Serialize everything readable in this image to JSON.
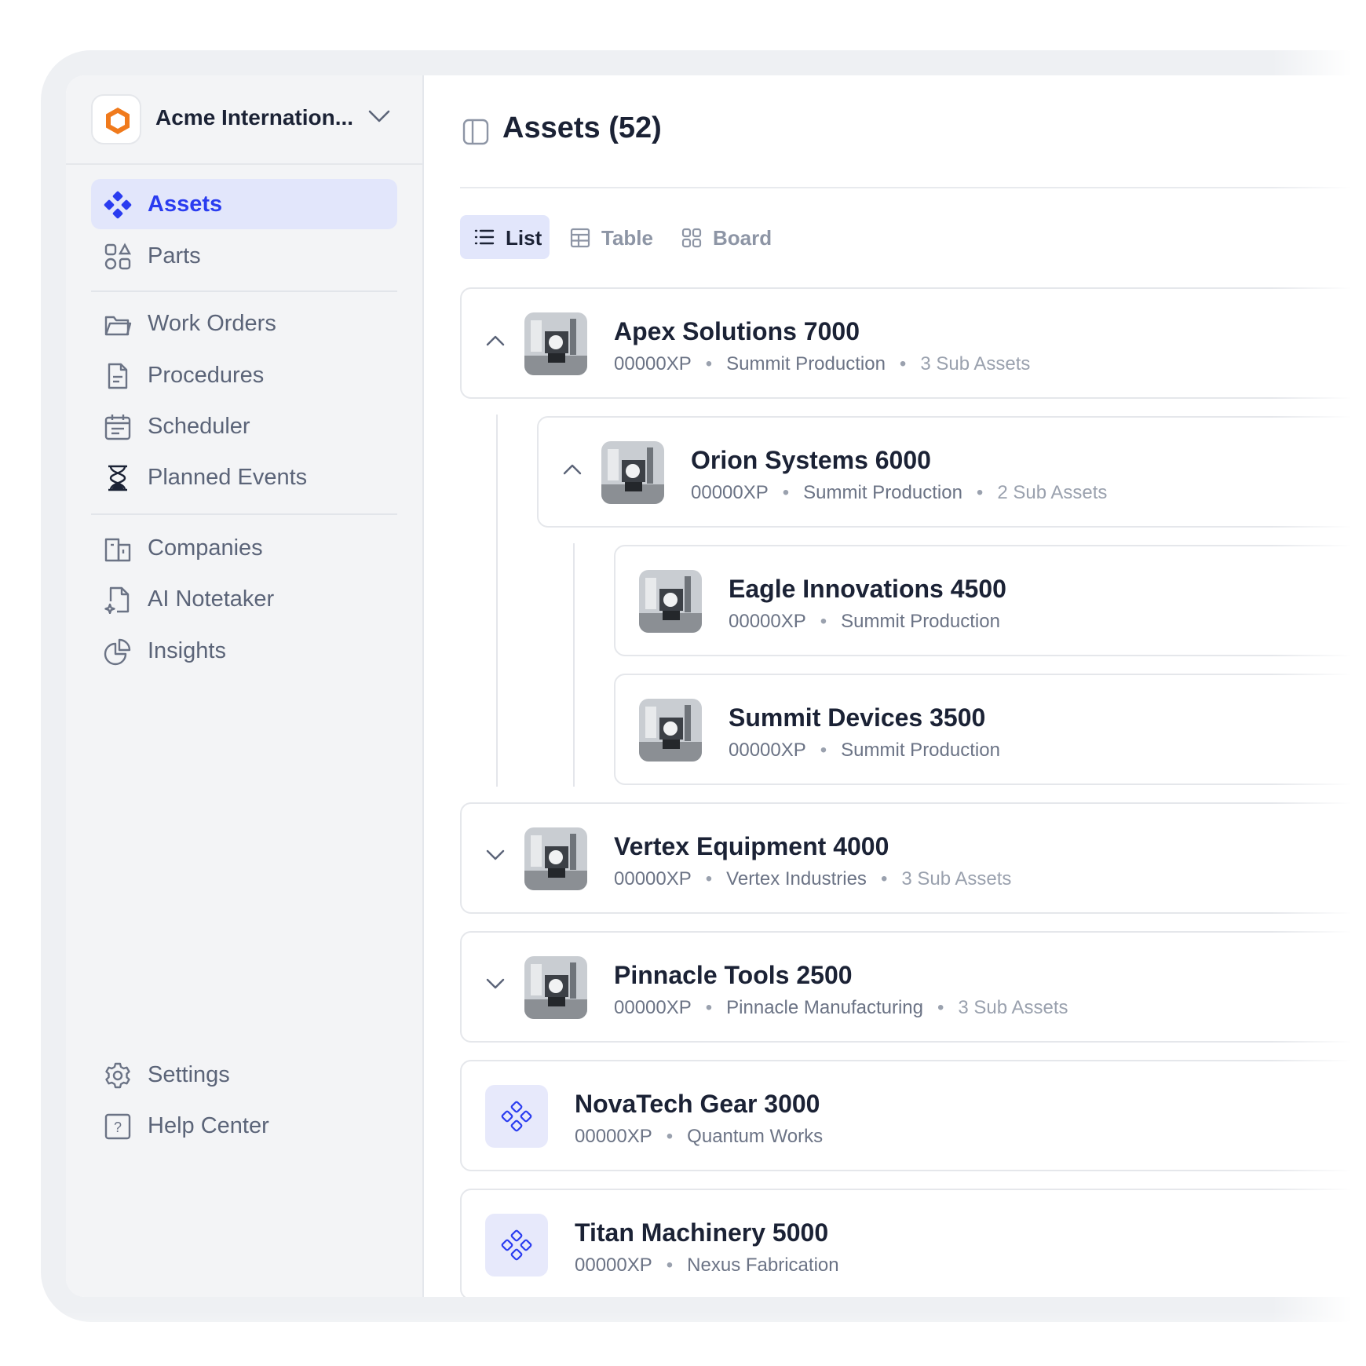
{
  "workspace": {
    "name": "Acme Internation...",
    "logo_color": "#f07a1c"
  },
  "nav": {
    "primary": [
      {
        "label": "Assets",
        "icon": "assets-icon",
        "active": true
      },
      {
        "label": "Parts",
        "icon": "parts-icon"
      }
    ],
    "secondary": [
      {
        "label": "Work Orders",
        "icon": "folder-icon"
      },
      {
        "label": "Procedures",
        "icon": "document-icon"
      },
      {
        "label": "Scheduler",
        "icon": "calendar-icon"
      },
      {
        "label": "Planned Events",
        "icon": "hourglass-icon"
      }
    ],
    "tertiary": [
      {
        "label": "Companies",
        "icon": "building-icon"
      },
      {
        "label": "AI Notetaker",
        "icon": "sparkle-doc-icon"
      },
      {
        "label": "Insights",
        "icon": "pie-chart-icon"
      }
    ],
    "footer": [
      {
        "label": "Settings",
        "icon": "gear-icon"
      },
      {
        "label": "Help Center",
        "icon": "help-icon"
      }
    ]
  },
  "main": {
    "title": "Assets (52)",
    "view_tabs": [
      {
        "label": "List",
        "icon": "list-icon",
        "active": true
      },
      {
        "label": "Table",
        "icon": "table-icon"
      },
      {
        "label": "Board",
        "icon": "board-icon"
      }
    ],
    "assets": [
      {
        "name": "Apex Solutions 7000",
        "code": "00000XP",
        "location": "Summit Production",
        "sub": "3 Sub Assets",
        "expanded": true
      },
      {
        "name": "Orion Systems 6000",
        "code": "00000XP",
        "location": "Summit Production",
        "sub": "2 Sub Assets",
        "expanded": true
      },
      {
        "name": "Eagle Innovations 4500",
        "code": "00000XP",
        "location": "Summit Production"
      },
      {
        "name": "Summit Devices 3500",
        "code": "00000XP",
        "location": "Summit Production"
      },
      {
        "name": "Vertex Equipment 4000",
        "code": "00000XP",
        "location": "Vertex Industries",
        "sub": "3 Sub Assets",
        "expanded": false
      },
      {
        "name": "Pinnacle Tools 2500",
        "code": "00000XP",
        "location": "Pinnacle Manufacturing",
        "sub": "3 Sub Assets",
        "expanded": false
      },
      {
        "name": "NovaTech Gear 3000",
        "code": "00000XP",
        "location": "Quantum Works"
      },
      {
        "name": "Titan Machinery 5000",
        "code": "00000XP",
        "location": "Nexus Fabrication"
      }
    ],
    "separator": "•"
  },
  "colors": {
    "accent": "#2a3cf0",
    "active_bg": "#e2e6fb",
    "sidebar_bg": "#f3f4f6"
  }
}
